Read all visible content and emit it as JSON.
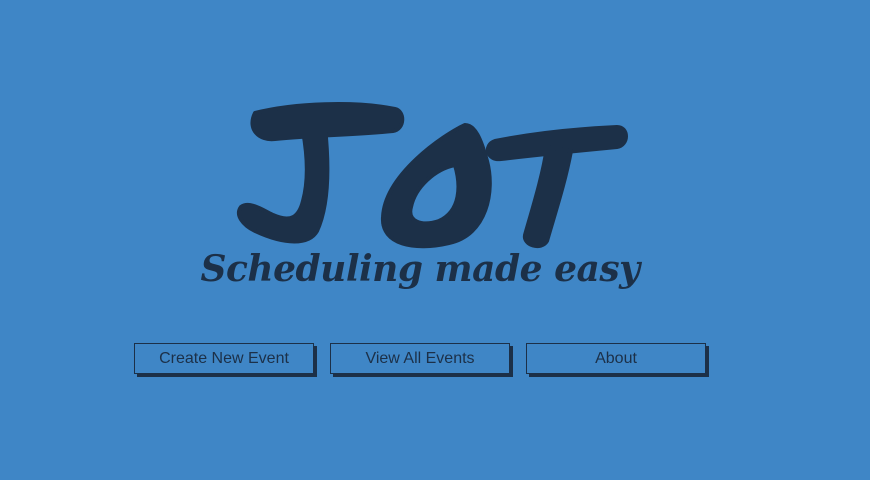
{
  "brand": {
    "logo_text": "JOT",
    "tagline": "Scheduling made easy"
  },
  "nav": {
    "create_label": "Create New Event",
    "view_all_label": "View All Events",
    "about_label": "About"
  },
  "colors": {
    "background": "#3f86c6",
    "ink": "#1c3048"
  }
}
